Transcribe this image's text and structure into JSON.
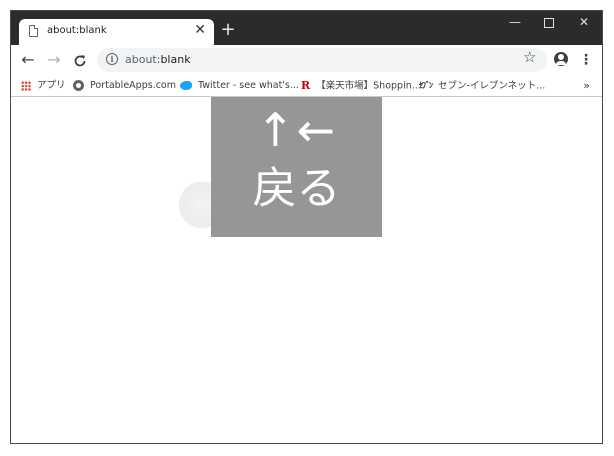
{
  "tab": {
    "title": "about:blank",
    "close": "✕",
    "icon": "page-icon"
  },
  "new_tab": "+",
  "window_controls": {
    "minimize": "—",
    "close": "✕"
  },
  "nav": {
    "back": "←",
    "forward": "→",
    "reload": "C"
  },
  "omnibox": {
    "url_dim": "about:",
    "url_main": "blank",
    "info": "i"
  },
  "toolbar": {
    "star": "☆",
    "menu": "⋮"
  },
  "bookmarks": [
    {
      "label": "アプリ",
      "icon": "apps-grid-icon"
    },
    {
      "label": "PortableApps.com",
      "icon": "globe-icon"
    },
    {
      "label": "Twitter - see what's...",
      "icon": "twitter-icon"
    },
    {
      "label": "【楽天市場】Shoppin...",
      "icon": "rakuten-icon",
      "glyph": "R"
    },
    {
      "label": "セブン-イレブンネット...",
      "icon": "seven-eleven-icon",
      "glyph": "ｾﾌﾞﾝ"
    }
  ],
  "bookmarks_more": "»",
  "overlay": {
    "arrows": "↑←",
    "label": "戻る"
  }
}
